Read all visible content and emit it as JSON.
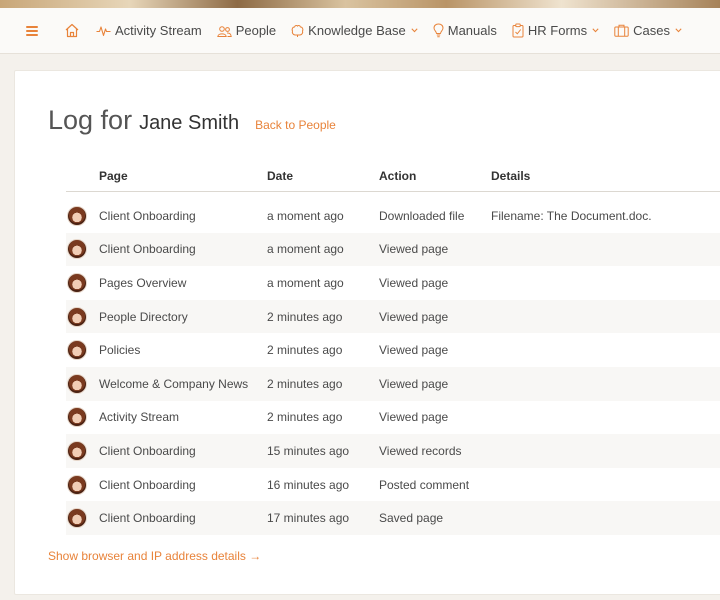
{
  "nav": {
    "items": [
      {
        "label": "Activity Stream",
        "icon": "activity-icon",
        "dropdown": false
      },
      {
        "label": "People",
        "icon": "people-icon",
        "dropdown": false
      },
      {
        "label": "Knowledge Base",
        "icon": "brain-icon",
        "dropdown": true
      },
      {
        "label": "Manuals",
        "icon": "lightbulb-icon",
        "dropdown": false
      },
      {
        "label": "HR Forms",
        "icon": "clipboard-icon",
        "dropdown": true
      },
      {
        "label": "Cases",
        "icon": "briefcase-icon",
        "dropdown": true
      }
    ]
  },
  "page": {
    "title": "Log for",
    "user_name": "Jane Smith",
    "back_link": "Back to People",
    "show_details": "Show browser and IP address details →"
  },
  "table": {
    "headers": {
      "page": "Page",
      "date": "Date",
      "action": "Action",
      "details": "Details"
    },
    "rows": [
      {
        "page": "Client Onboarding",
        "date": "a moment ago",
        "action": "Downloaded file",
        "details": "Filename: The Document.doc."
      },
      {
        "page": "Client Onboarding",
        "date": "a moment ago",
        "action": "Viewed page",
        "details": ""
      },
      {
        "page": "Pages Overview",
        "date": "a moment ago",
        "action": "Viewed page",
        "details": ""
      },
      {
        "page": "People Directory",
        "date": "2 minutes ago",
        "action": "Viewed page",
        "details": ""
      },
      {
        "page": "Policies",
        "date": "2 minutes ago",
        "action": "Viewed page",
        "details": ""
      },
      {
        "page": "Welcome & Company News",
        "date": "2 minutes ago",
        "action": "Viewed page",
        "details": ""
      },
      {
        "page": "Activity Stream",
        "date": "2 minutes ago",
        "action": "Viewed page",
        "details": ""
      },
      {
        "page": "Client Onboarding",
        "date": "15 minutes ago",
        "action": "Viewed records",
        "details": ""
      },
      {
        "page": "Client Onboarding",
        "date": "16 minutes ago",
        "action": "Posted comment",
        "details": ""
      },
      {
        "page": "Client Onboarding",
        "date": "17 minutes ago",
        "action": "Saved page",
        "details": ""
      }
    ]
  },
  "colors": {
    "accent": "#e8833a",
    "text": "#4a4a4a",
    "stripe": "#f8f7f5"
  }
}
